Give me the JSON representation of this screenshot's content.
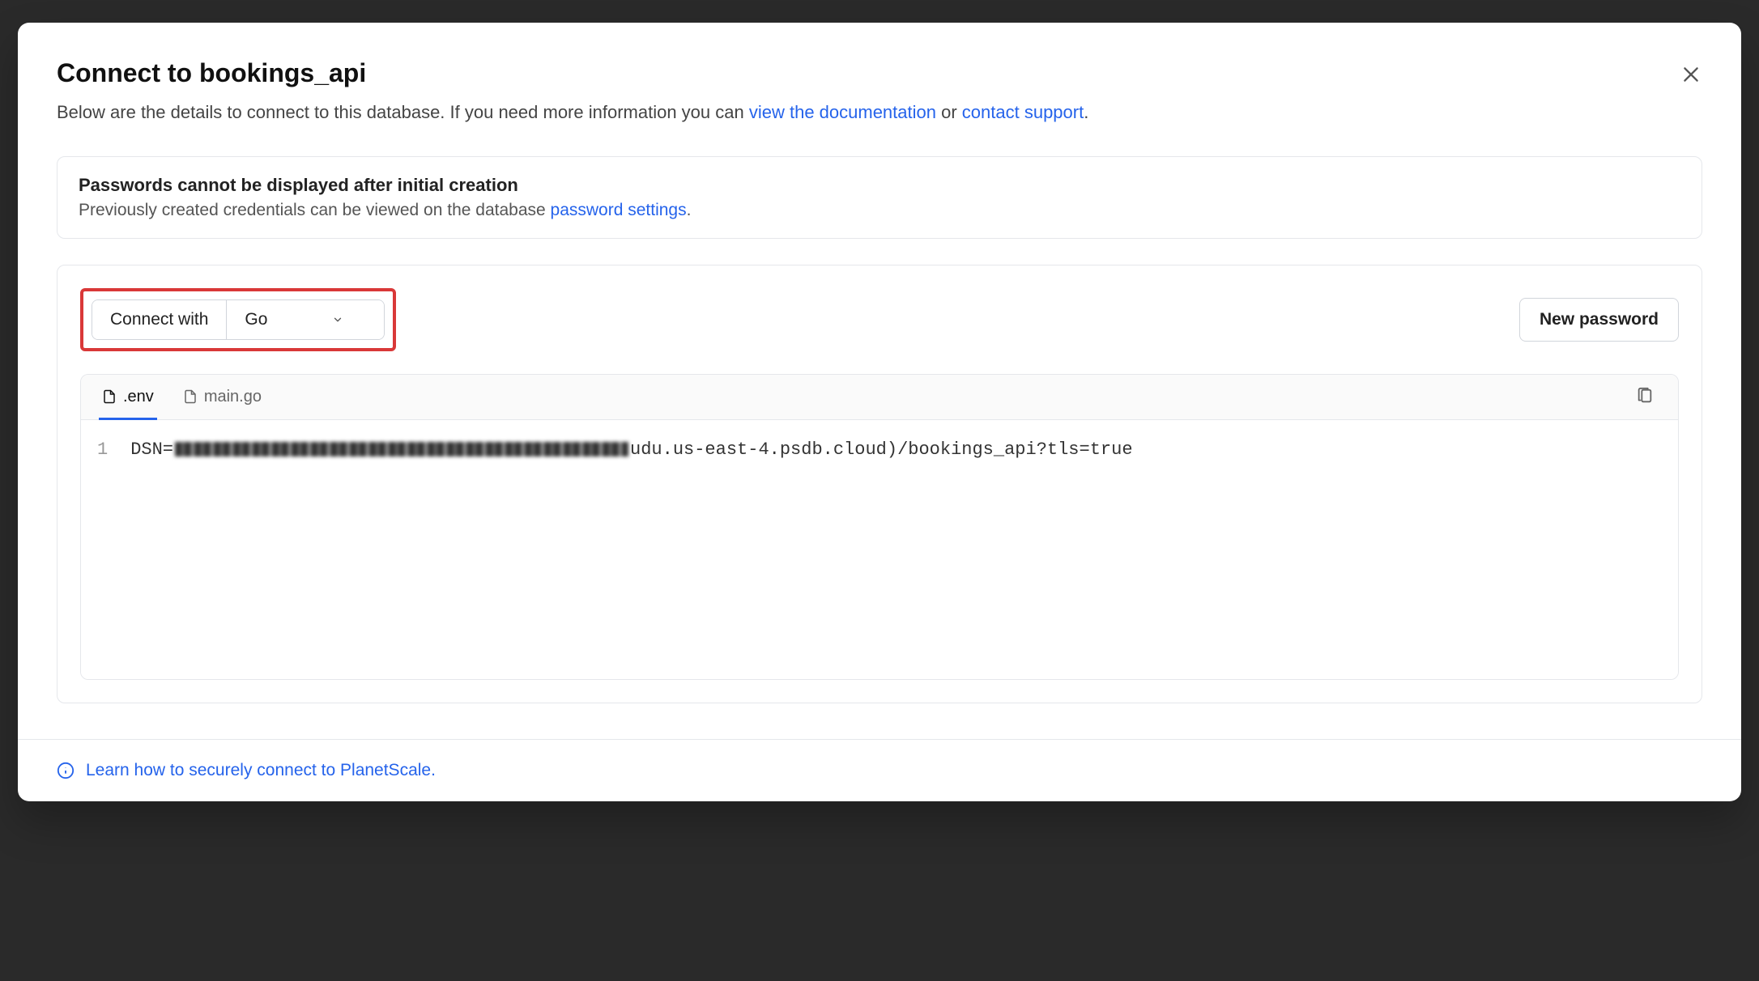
{
  "header": {
    "title": "Connect to bookings_api",
    "subtitle_pre": "Below are the details to connect to this database. If you need more information you can ",
    "doc_link": "view the documentation",
    "subtitle_mid": " or ",
    "support_link": "contact support",
    "subtitle_end": "."
  },
  "notice": {
    "title": "Passwords cannot be displayed after initial creation",
    "body_pre": "Previously created credentials can be viewed on the database ",
    "settings_link": "password settings",
    "body_end": "."
  },
  "connect": {
    "label": "Connect with",
    "selected": "Go",
    "new_password_label": "New password"
  },
  "tabs": {
    "env": ".env",
    "main": "main.go"
  },
  "code": {
    "line_number": "1",
    "dsn_prefix": "DSN=",
    "dsn_suffix": "udu.us-east-4.psdb.cloud)/bookings_api?tls=true"
  },
  "footer": {
    "link": "Learn how to securely connect to PlanetScale."
  }
}
